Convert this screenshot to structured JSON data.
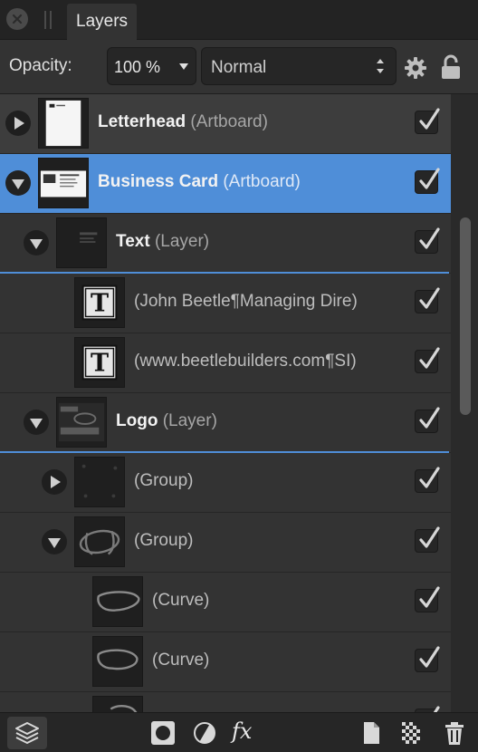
{
  "panel": {
    "tab_label": "Layers"
  },
  "toolbar": {
    "opacity_label": "Opacity:",
    "opacity_value": "100 %",
    "blend_mode": "Normal"
  },
  "layers": [
    {
      "name": "Letterhead",
      "type": "(Artboard)",
      "expanded": false,
      "visible": true
    },
    {
      "name": "Business Card",
      "type": "(Artboard)",
      "expanded": true,
      "visible": true,
      "selected": true
    },
    {
      "name": "Text",
      "type": "(Layer)",
      "expanded": true,
      "visible": true
    },
    {
      "name": "(John Beetle¶Managing Dire)",
      "visible": true
    },
    {
      "name": "(www.beetlebuilders.com¶SI)",
      "visible": true
    },
    {
      "name": "Logo",
      "type": "(Layer)",
      "expanded": true,
      "visible": true
    },
    {
      "name": "(Group)",
      "expanded": false,
      "visible": true
    },
    {
      "name": "(Group)",
      "expanded": true,
      "visible": true
    },
    {
      "name": "(Curve)",
      "visible": true
    },
    {
      "name": "(Curve)",
      "visible": true
    }
  ],
  "colors": {
    "selection": "#4f8ed8",
    "panel_bg": "#333333"
  }
}
